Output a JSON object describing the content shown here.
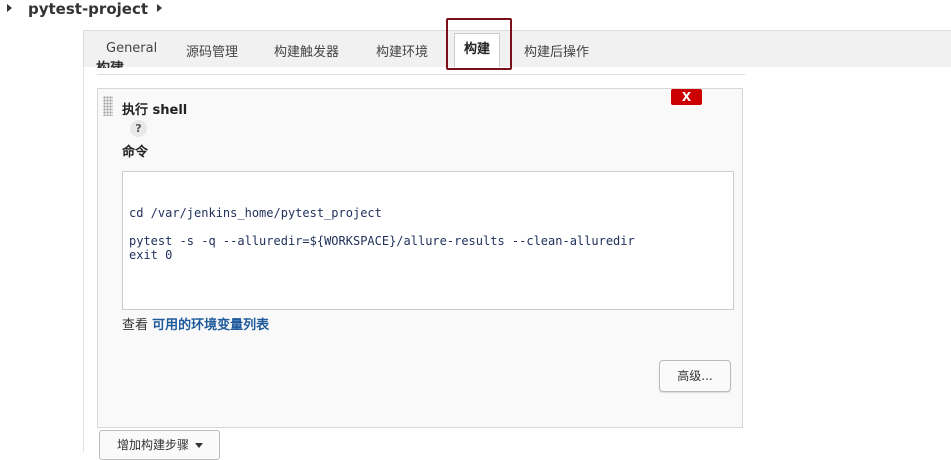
{
  "breadcrumb": {
    "project": "pytest-project"
  },
  "tabs": [
    {
      "label": "General"
    },
    {
      "label": "源码管理"
    },
    {
      "label": "构建触发器"
    },
    {
      "label": "构建环境"
    },
    {
      "label": "构建",
      "active": true
    },
    {
      "label": "构建后操作"
    }
  ],
  "section": {
    "title": "构建"
  },
  "step": {
    "title": "执行 shell",
    "delete_label": "X",
    "help_label": "?",
    "command_label": "命令",
    "command_lines": [
      "cd /var/jenkins_home/pytest_project",
      "pytest -s -q --alluredir=${WORKSPACE}/allure-results --clean-alluredir",
      "exit 0"
    ],
    "env_prefix": "查看 ",
    "env_link": "可用的环境变量列表",
    "advanced_label": "高级..."
  },
  "add_step_label": "增加构建步骤",
  "colors": {
    "highlight": "#7a0f1c",
    "delete": "#cc0000",
    "link": "#1e5a9c"
  },
  "icons": [
    "breadcrumb-arrow-icon",
    "drag-handle-icon",
    "help-icon",
    "dropdown-caret-icon"
  ]
}
